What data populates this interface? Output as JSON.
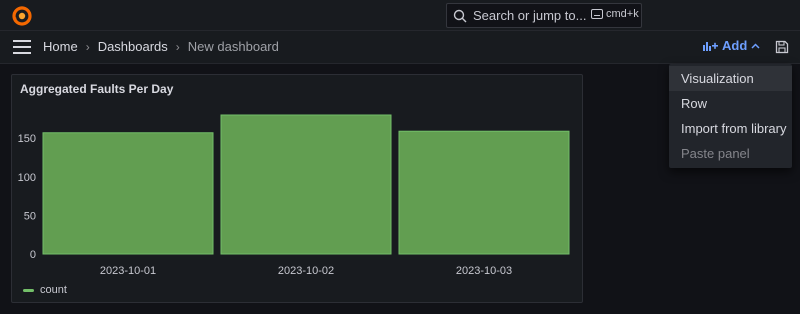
{
  "topbar": {
    "search_placeholder": "Search or jump to...",
    "shortcut": "cmd+k"
  },
  "breadcrumb": {
    "home": "Home",
    "dashboards": "Dashboards",
    "current": "New dashboard"
  },
  "toolbar": {
    "add_label": "Add"
  },
  "add_menu": {
    "items": [
      "Visualization",
      "Row",
      "Import from library",
      "Paste panel"
    ]
  },
  "panel": {
    "title": "Aggregated Faults Per Day",
    "legend_label": "count"
  },
  "colors": {
    "bar_fill": "#629e51",
    "bar_stroke": "#73bf69",
    "accent": "#6e9fff",
    "logo": "#f46800"
  },
  "chart_data": {
    "type": "bar",
    "title": "Aggregated Faults Per Day",
    "categories": [
      "2023-10-01",
      "2023-10-02",
      "2023-10-03"
    ],
    "series": [
      {
        "name": "count",
        "values": [
          157,
          180,
          159
        ]
      }
    ],
    "yticks": [
      0,
      50,
      100,
      150
    ],
    "ylim": [
      0,
      180
    ],
    "legend": "bottom-left"
  }
}
